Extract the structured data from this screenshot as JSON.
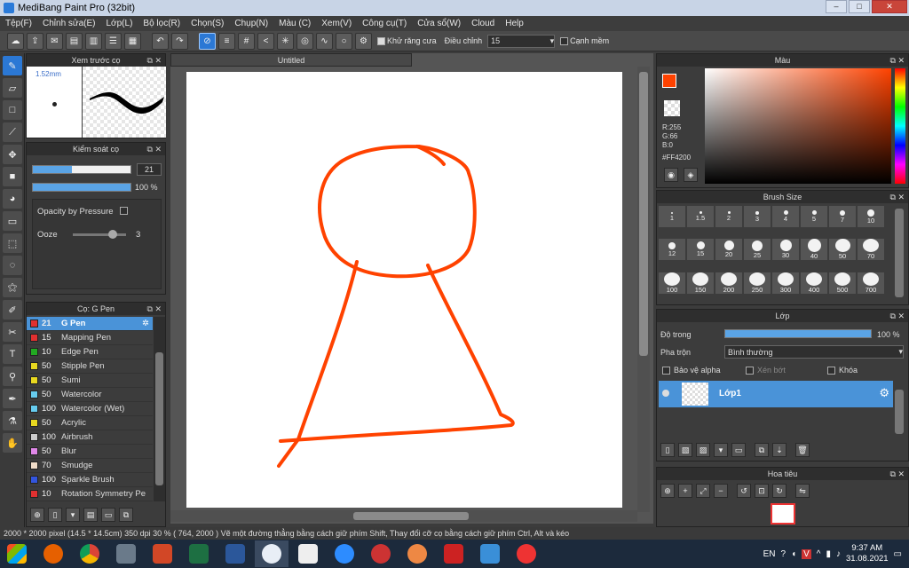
{
  "window": {
    "title": "MediBang Paint Pro (32bit)",
    "minimize": "–",
    "maximize": "□",
    "close": "✕"
  },
  "menu": [
    "Tệp(F)",
    "Chỉnh sửa(E)",
    "Lớp(L)",
    "Bộ lọc(R)",
    "Chọn(S)",
    "Chụp(N)",
    "Màu (C)",
    "Xem(V)",
    "Công cụ(T)",
    "Cửa sổ(W)",
    "Cloud",
    "Help"
  ],
  "toolbar": {
    "antialias_label": "Khử răng cưa",
    "adjust_label": "Điều chỉnh",
    "adjust_value": "15",
    "smooth_label": "Cạnh mềm"
  },
  "preview_panel": {
    "title": "Xem trước cọ",
    "size_label": "1.52mm"
  },
  "brush_control": {
    "title": "Kiểm soát cọ",
    "size_value": "21",
    "opacity_value": "100 %",
    "opacity_pressure_label": "Opacity by Pressure",
    "ooze_label": "Ooze",
    "ooze_value": "3",
    "size_fill": 0.4,
    "opacity_fill": 1.0,
    "ooze_fill": 0.75
  },
  "brush_list": {
    "title": "Cọ: G Pen",
    "items": [
      {
        "size": "21",
        "name": "G Pen",
        "color": "#e03030",
        "selected": true
      },
      {
        "size": "15",
        "name": "Mapping Pen",
        "color": "#e03030"
      },
      {
        "size": "10",
        "name": "Edge Pen",
        "color": "#22aa22"
      },
      {
        "size": "50",
        "name": "Stipple Pen",
        "color": "#e8d820"
      },
      {
        "size": "50",
        "name": "Sumi",
        "color": "#e8d820"
      },
      {
        "size": "50",
        "name": "Watercolor",
        "color": "#66ccee"
      },
      {
        "size": "100",
        "name": "Watercolor (Wet)",
        "color": "#66ccee"
      },
      {
        "size": "50",
        "name": "Acrylic",
        "color": "#e8d820"
      },
      {
        "size": "100",
        "name": "Airbrush",
        "color": "#cccccc"
      },
      {
        "size": "50",
        "name": "Blur",
        "color": "#e088e8"
      },
      {
        "size": "70",
        "name": "Smudge",
        "color": "#f0dcc8"
      },
      {
        "size": "100",
        "name": "Sparkle Brush",
        "color": "#3355dd"
      },
      {
        "size": "10",
        "name": "Rotation Symmetry Pe",
        "color": "#e03030"
      }
    ]
  },
  "document": {
    "tab": "Untitled"
  },
  "color_panel": {
    "title": "Màu",
    "r": "R:255",
    "g": "G:66",
    "b": "B:0",
    "hex": "#FF4200",
    "current_color": "#ff4200"
  },
  "brush_size_panel": {
    "title": "Brush Size",
    "sizes": [
      "1",
      "1.5",
      "2",
      "3",
      "4",
      "5",
      "7",
      "10",
      "12",
      "15",
      "20",
      "25",
      "30",
      "40",
      "50",
      "70",
      "100",
      "150",
      "200",
      "250",
      "300",
      "400",
      "500",
      "700"
    ]
  },
  "layer_panel": {
    "title": "Lớp",
    "opacity_label": "Độ trong",
    "opacity_value": "100 %",
    "opacity_fill": 1.0,
    "blend_label": "Pha trộn",
    "blend_value": "Bình thường",
    "protect_alpha": "Bảo vệ alpha",
    "clip": "Xén bớt",
    "lock": "Khóa",
    "layer_name": "Lớp1"
  },
  "navigator_panel": {
    "title": "Hoa tiêu"
  },
  "status": {
    "text": "2000 * 2000 pixel   (14.5 * 14.5cm)   350 dpi   30 %   ( 764, 2000 )   Vẽ một đường thẳng bằng cách giữ phím Shift, Thay đổi cỡ cọ bằng cách giữ phím Ctrl, Alt và kéo"
  },
  "taskbar": {
    "lang": "EN",
    "time": "9:37 AM",
    "date": "31.08.2021"
  }
}
